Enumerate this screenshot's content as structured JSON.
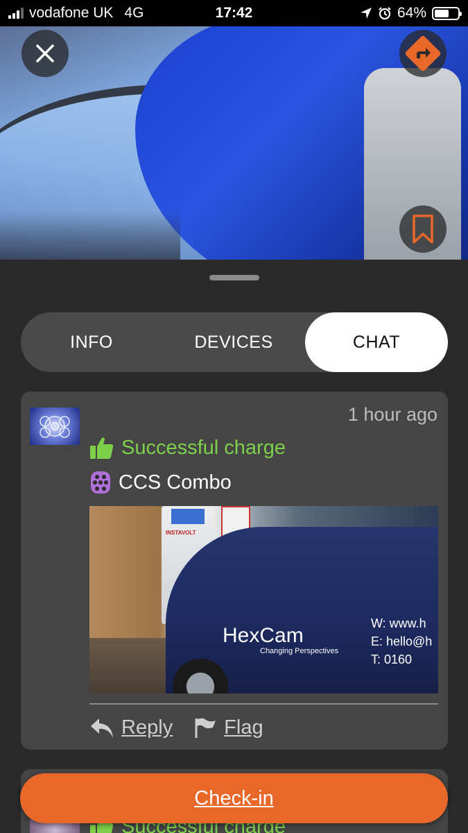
{
  "status_bar": {
    "carrier": "vodafone UK",
    "network": "4G",
    "time": "17:42",
    "battery": "64%",
    "battery_level": 0.64
  },
  "hero": {
    "close_icon": "close-icon",
    "share_icon": "directions-icon",
    "bookmark_icon": "bookmark-icon"
  },
  "tabs": [
    {
      "label": "INFO",
      "selected": false
    },
    {
      "label": "DEVICES",
      "selected": false
    },
    {
      "label": "CHAT",
      "selected": true
    }
  ],
  "posts": [
    {
      "time_ago": "1 hour ago",
      "status": "Successful charge",
      "connector": "CCS Combo",
      "photo": {
        "brand": "HexCam",
        "tagline": "Changing Perspectives",
        "contact_lines": [
          "W: www.h",
          "E: hello@h",
          "T: 0160"
        ],
        "charger_brand": "INSTAVOLT"
      },
      "actions": {
        "reply": "Reply",
        "flag": "Flag"
      }
    },
    {
      "status": "Successful charge"
    }
  ],
  "checkin_label": "Check-in",
  "colors": {
    "accent": "#e8682a",
    "success": "#7ed04b",
    "connector": "#b06fd8",
    "card": "#454545",
    "background": "#2a2a2a"
  }
}
